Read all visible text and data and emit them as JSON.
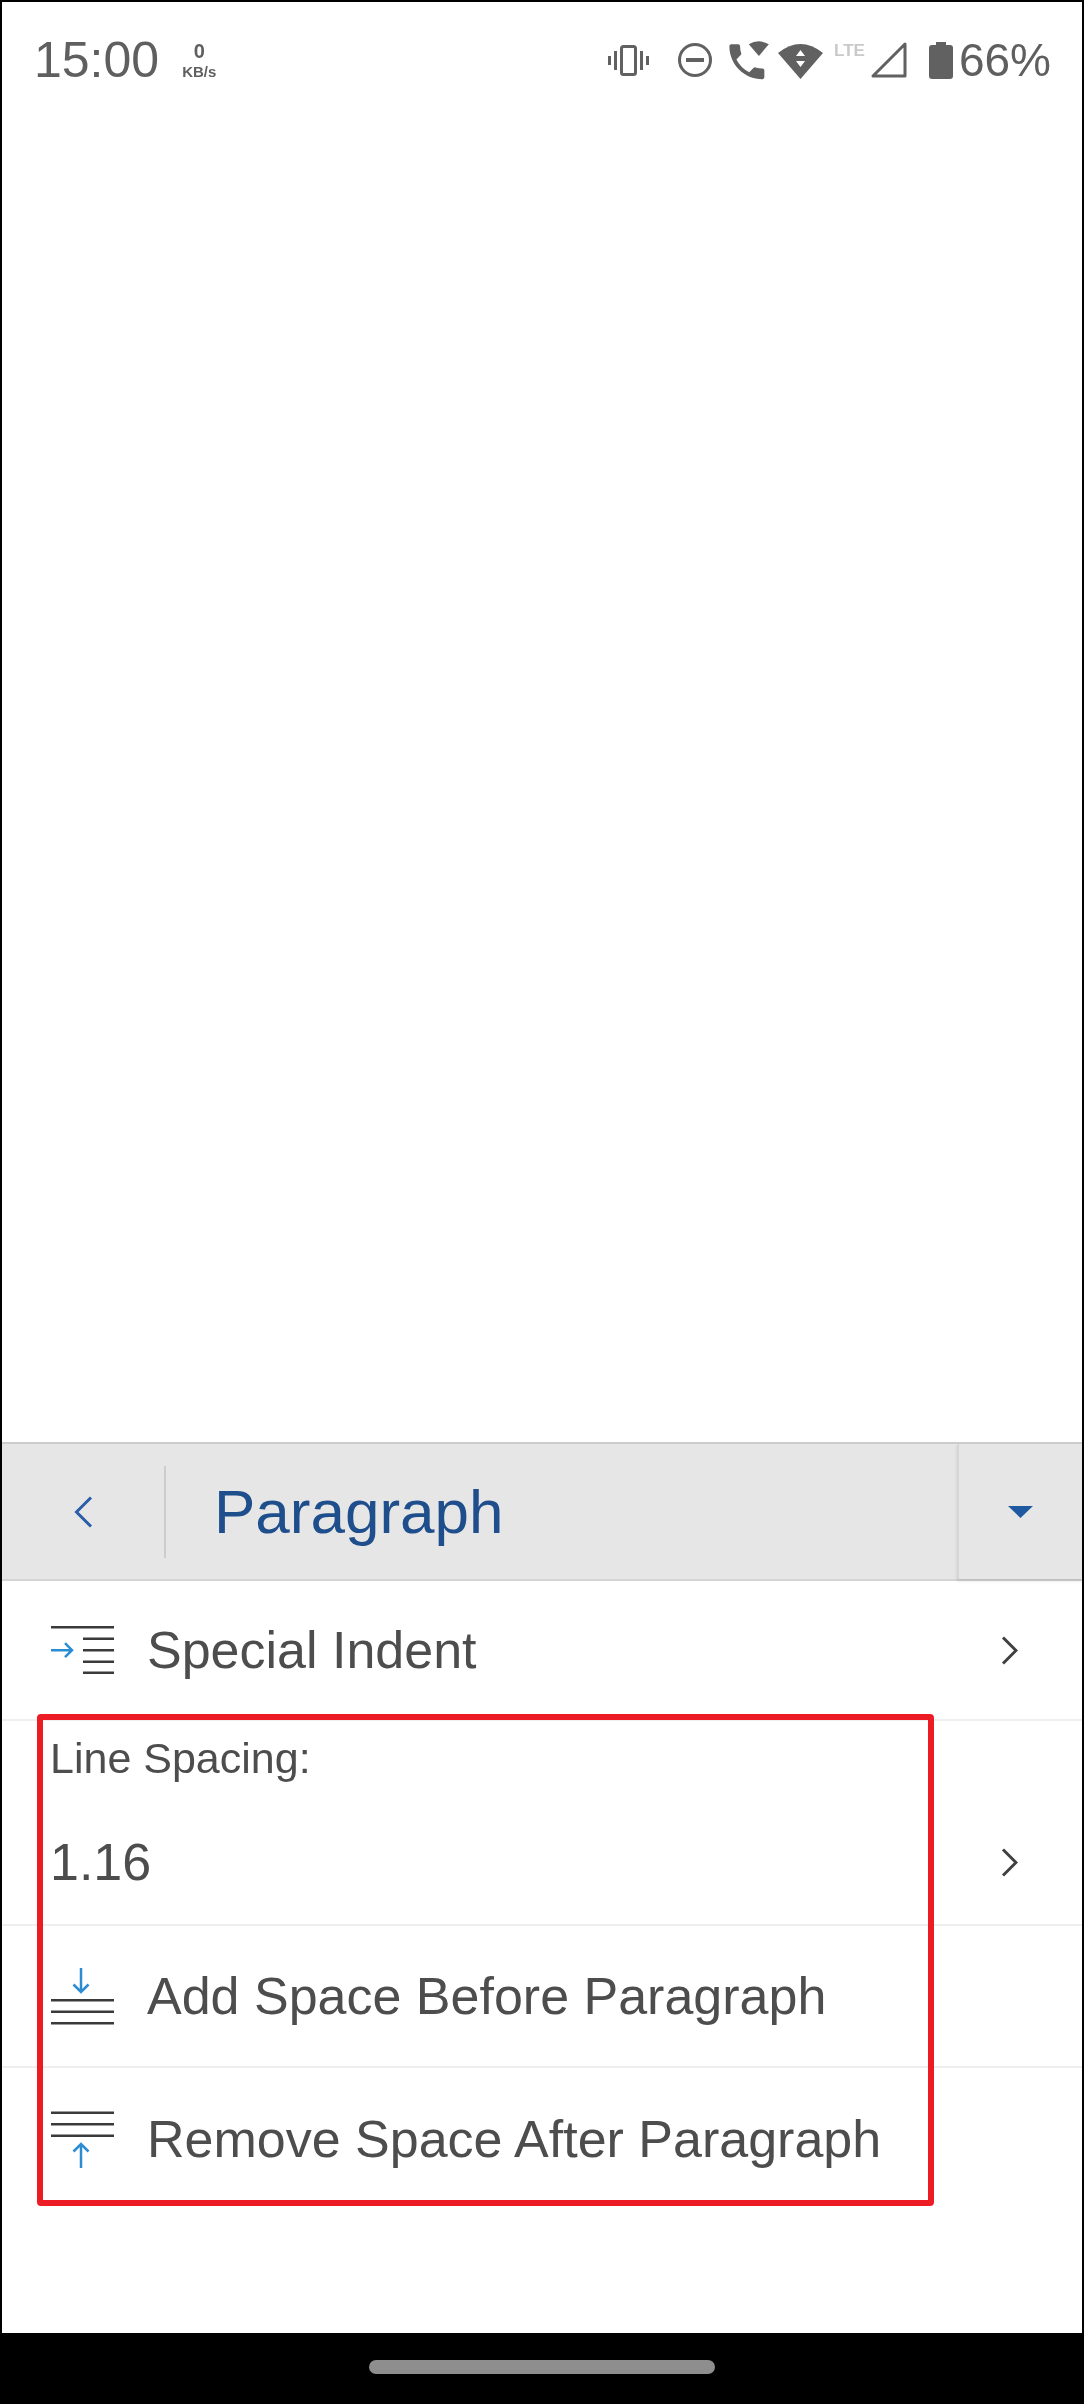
{
  "status_bar": {
    "time": "15:00",
    "network_speed": {
      "value": "0",
      "unit": "KB/s"
    },
    "network_type": "LTE",
    "battery": "66%"
  },
  "panel": {
    "title": "Paragraph"
  },
  "sections": [
    {
      "highlighted": false,
      "items": [
        {
          "kind": "submenu",
          "label": "Special Indent"
        }
      ]
    },
    {
      "highlighted": true,
      "items": [
        {
          "kind": "setting",
          "label": "Line Spacing:",
          "value": "1.16"
        },
        {
          "kind": "action",
          "label": "Add Space Before Paragraph"
        },
        {
          "kind": "action",
          "label": "Remove Space After Paragraph"
        }
      ]
    }
  ]
}
